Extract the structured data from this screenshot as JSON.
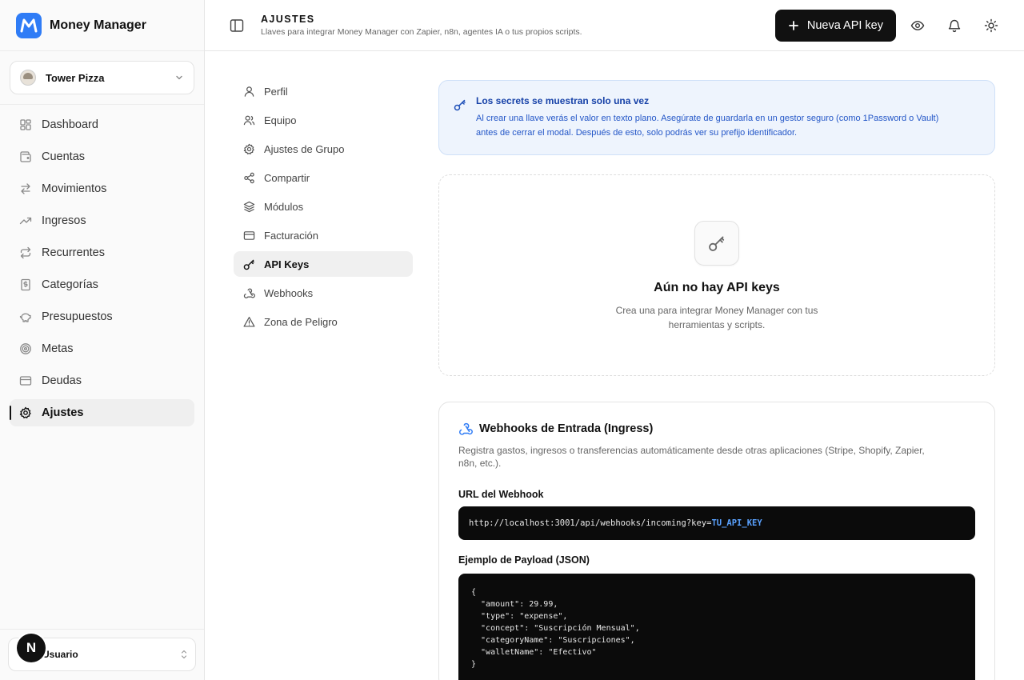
{
  "app": {
    "name": "Money Manager",
    "brand_color": "#2f7cf6"
  },
  "workspace": {
    "name": "Tower Pizza"
  },
  "sidebar": {
    "items": [
      {
        "label": "Dashboard",
        "icon": "grid-icon"
      },
      {
        "label": "Cuentas",
        "icon": "wallet-icon"
      },
      {
        "label": "Movimientos",
        "icon": "arrows-left-right-icon"
      },
      {
        "label": "Ingresos",
        "icon": "trending-up-icon"
      },
      {
        "label": "Recurrentes",
        "icon": "repeat-icon"
      },
      {
        "label": "Categorías",
        "icon": "receipt-icon"
      },
      {
        "label": "Presupuestos",
        "icon": "piggy-bank-icon"
      },
      {
        "label": "Metas",
        "icon": "target-icon"
      },
      {
        "label": "Deudas",
        "icon": "credit-card-icon"
      },
      {
        "label": "Ajustes",
        "icon": "gear-icon",
        "active": true
      }
    ]
  },
  "user": {
    "initial": "N",
    "name": "Usuario"
  },
  "header": {
    "title": "AJUSTES",
    "subtitle": "Llaves para integrar Money Manager con Zapier, n8n, agentes IA o tus propios scripts.",
    "new_key_label": "Nueva API key"
  },
  "settings_nav": {
    "items": [
      {
        "label": "Perfil",
        "icon": "user-icon"
      },
      {
        "label": "Equipo",
        "icon": "users-icon"
      },
      {
        "label": "Ajustes de Grupo",
        "icon": "gear-icon"
      },
      {
        "label": "Compartir",
        "icon": "share-icon"
      },
      {
        "label": "Módulos",
        "icon": "layers-icon"
      },
      {
        "label": "Facturación",
        "icon": "credit-card-icon"
      },
      {
        "label": "API Keys",
        "icon": "key-icon",
        "active": true
      },
      {
        "label": "Webhooks",
        "icon": "webhook-icon"
      },
      {
        "label": "Zona de Peligro",
        "icon": "warning-icon"
      }
    ]
  },
  "info_banner": {
    "title": "Los secrets se muestran solo una vez",
    "line1": "Al crear una llave verás el valor en texto plano. Asegúrate de guardarla en un gestor seguro (como 1Password o Vault)",
    "line2": "antes de cerrar el modal. Después de esto, solo podrás ver su prefijo identificador."
  },
  "empty_state": {
    "title": "Aún no hay API keys",
    "line1": "Crea una para integrar Money Manager con tus",
    "line2": "herramientas y scripts."
  },
  "webhooks": {
    "title": "Webhooks de Entrada (Ingress)",
    "description_line1": "Registra gastos, ingresos o transferencias automáticamente desde otras aplicaciones (Stripe, Shopify, Zapier,",
    "description_line2": "n8n, etc.).",
    "url_label": "URL del Webhook",
    "url_base": "http://localhost:3001/api/webhooks/incoming?key=",
    "url_key": "TU_API_KEY",
    "payload_label": "Ejemplo de Payload (JSON)",
    "payload_lines": [
      "{",
      "  \"amount\": 29.99,",
      "  \"type\": \"expense\",",
      "  \"concept\": \"Suscripción Mensual\",",
      "  \"categoryName\": \"Suscripciones\",",
      "  \"walletName\": \"Efectivo\"",
      "}"
    ]
  }
}
